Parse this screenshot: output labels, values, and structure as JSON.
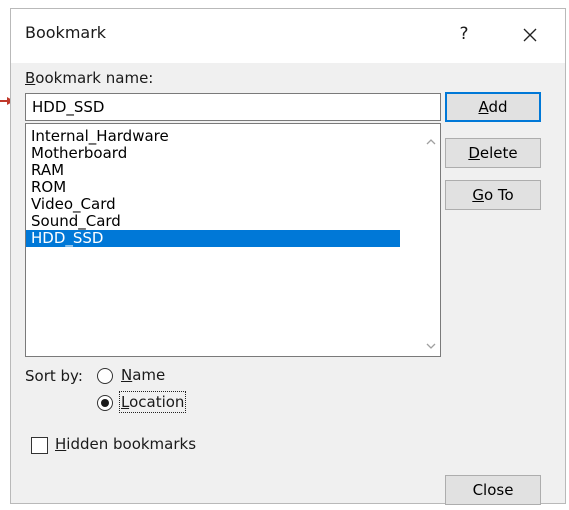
{
  "dialog": {
    "title": "Bookmark",
    "help_label": "?",
    "close_label": "✕"
  },
  "bookmark_name": {
    "label_prefix": "",
    "label_mnemonic": "B",
    "label_rest": "ookmark name:",
    "value": "HDD_SSD"
  },
  "bookmarks": {
    "items": [
      {
        "label": "Internal_Hardware"
      },
      {
        "label": "Motherboard"
      },
      {
        "label": "RAM"
      },
      {
        "label": "ROM"
      },
      {
        "label": "Video_Card"
      },
      {
        "label": "Sound_Card"
      },
      {
        "label": "HDD_SSD"
      }
    ],
    "selected_index": 6
  },
  "buttons": {
    "add": {
      "mnemonic": "A",
      "rest": "dd"
    },
    "delete": {
      "mnemonic": "D",
      "rest": "elete"
    },
    "goto": {
      "mnemonic": "G",
      "rest": "o To"
    },
    "close": "Close"
  },
  "sort": {
    "label": "Sort by:",
    "name_option": {
      "mnemonic": "N",
      "rest": "ame",
      "checked": false
    },
    "location_option": {
      "mnemonic": "L",
      "rest": "ocation",
      "checked": true
    }
  },
  "hidden": {
    "mnemonic": "H",
    "rest": "idden bookmarks",
    "checked": false
  },
  "colors": {
    "selection": "#0078d7",
    "arrow": "#c0392b",
    "dialog_bg": "#f0f0f0"
  }
}
